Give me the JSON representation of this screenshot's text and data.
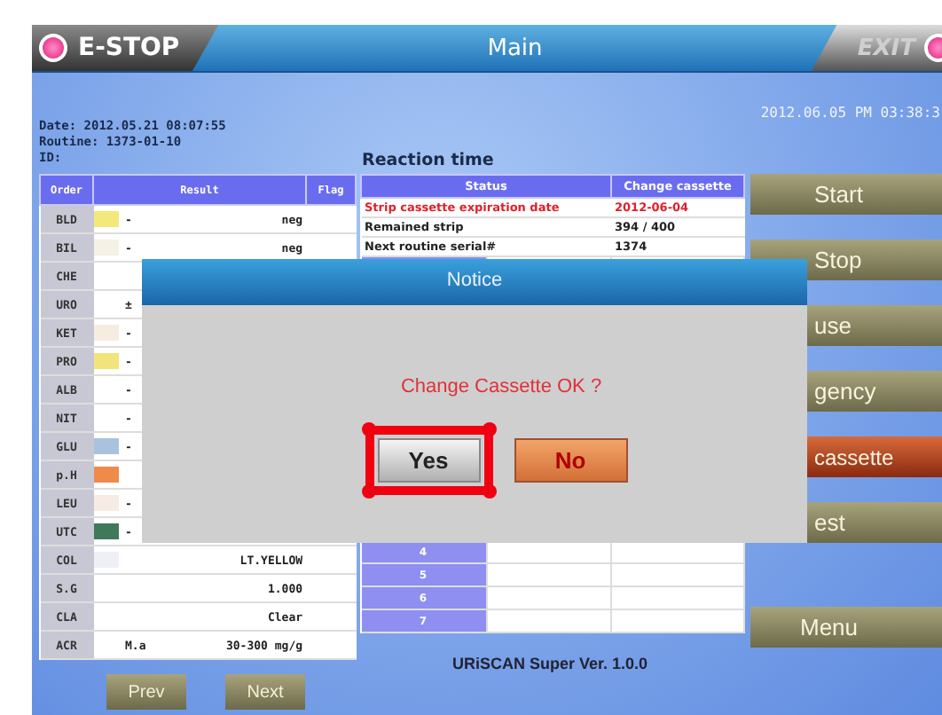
{
  "title_bar": {
    "estop": "E-STOP",
    "title": "Main",
    "exit": "EXIT"
  },
  "info": {
    "date": "Date: 2012.05.21   08:07:55",
    "routine": "Routine: 1373-01-10",
    "id": "ID:",
    "clock": "2012.06.05 PM 03:38:3",
    "reaction_label": "Reaction time"
  },
  "results": {
    "columns": [
      "Order",
      "Result",
      "Flag"
    ],
    "rows": [
      {
        "order": "BLD",
        "color": "#f3e97a",
        "result": "-",
        "value": "neg"
      },
      {
        "order": "BIL",
        "color": "#f6f1e6",
        "result": "-",
        "value": "neg"
      },
      {
        "order": "CHE"
      },
      {
        "order": "URO",
        "result": "±"
      },
      {
        "order": "KET",
        "color": "#f6ece0",
        "result": "-"
      },
      {
        "order": "PRO",
        "color": "#f0e47a",
        "result": "-"
      },
      {
        "order": "ALB",
        "result": "-"
      },
      {
        "order": "NIT",
        "result": "-"
      },
      {
        "order": "GLU",
        "color": "#a9c3de",
        "result": "-"
      },
      {
        "order": "p.H",
        "color": "#f08a4b"
      },
      {
        "order": "LEU",
        "color": "#f7ebe5",
        "result": "-"
      },
      {
        "order": "UTC",
        "color": "#3e7a5a",
        "result": "-"
      },
      {
        "order": "COL",
        "color": "#eef0f6",
        "value": "LT.YELLOW"
      },
      {
        "order": "S.G",
        "value": "1.000"
      },
      {
        "order": "CLA",
        "value": "Clear"
      },
      {
        "order": "ACR",
        "result": "M.a",
        "value": "30-300 mg/g"
      }
    ]
  },
  "status": {
    "columns": [
      "Status",
      "Change cassette"
    ],
    "rows": [
      {
        "label": "Strip cassette expiration date",
        "value": "2012-06-04",
        "alert": true
      },
      {
        "label": "Remained strip",
        "value": "394 / 400",
        "alert": false
      },
      {
        "label": "Next routine serial#",
        "value": "1374",
        "alert": false
      }
    ],
    "numbered_rows": [
      "4",
      "5",
      "6",
      "7"
    ]
  },
  "side_buttons": [
    {
      "label": "Start",
      "kind": "normal"
    },
    {
      "label": "Stop",
      "kind": "normal"
    },
    {
      "label": "use",
      "kind": "normal"
    },
    {
      "label": "gency",
      "kind": "normal"
    },
    {
      "label": "cassette",
      "kind": "alert"
    },
    {
      "label": "est",
      "kind": "normal"
    }
  ],
  "menu_button": "Menu",
  "nav_buttons": [
    "Prev",
    "Next"
  ],
  "version": "URiSCAN Super Ver. 1.0.0",
  "dialog": {
    "title": "Notice",
    "message": "Change Cassette OK ?",
    "buttons": [
      {
        "label": "Yes",
        "kind": "normal",
        "highlighted": true
      },
      {
        "label": "No",
        "kind": "danger",
        "highlighted": false
      }
    ]
  }
}
